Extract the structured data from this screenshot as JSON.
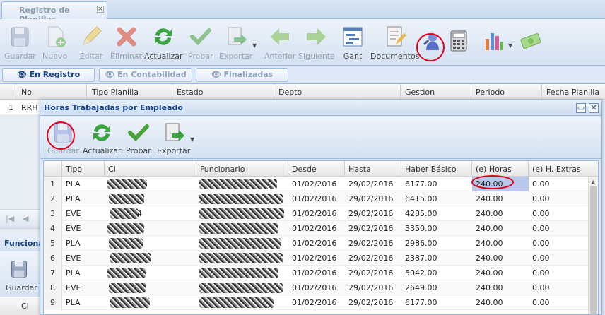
{
  "app_tab": {
    "title": "Registro de Planillas",
    "close": "×"
  },
  "toolbar": [
    {
      "label": "Guardar",
      "icon": "floppy-icon"
    },
    {
      "label": "Nuevo",
      "icon": "new-document-icon"
    },
    {
      "label": "Editar",
      "icon": "pencil-icon"
    },
    {
      "label": "Eliminar",
      "icon": "red-x-icon"
    },
    {
      "label": "Actualizar",
      "icon": "refresh-icon"
    },
    {
      "label": "Probar",
      "icon": "checkmark-icon"
    },
    {
      "label": "Exportar",
      "icon": "export-icon"
    },
    {
      "label": "Anterior",
      "icon": "arrow-left-icon"
    },
    {
      "label": "Siguiente",
      "icon": "arrow-right-icon"
    },
    {
      "label": "Gant",
      "icon": "gantt-icon"
    },
    {
      "label": "Documentos",
      "icon": "documents-icon"
    }
  ],
  "subtabs": [
    {
      "label": "En Registro",
      "icon": "eye-icon"
    },
    {
      "label": "En Contabilidad",
      "icon": "eye-icon"
    },
    {
      "label": "Finalizadas",
      "icon": "eye-icon"
    }
  ],
  "bg_grid": {
    "columns": [
      "No",
      "Tipo Planilla",
      "Estado",
      "Depto",
      "Gestion",
      "Periodo",
      "Fecha Planilla"
    ],
    "row_number": "1",
    "row_value": "RRH",
    "panel_title": "Funcionarios",
    "guardar": "Guardar",
    "ci": "CI"
  },
  "window": {
    "title": "Horas Trabajadas por Empleado",
    "toolbar": [
      {
        "label": "Guardar",
        "icon": "floppy-icon"
      },
      {
        "label": "Actualizar",
        "icon": "refresh-icon"
      },
      {
        "label": "Probar",
        "icon": "checkmark-icon"
      },
      {
        "label": "Exportar",
        "icon": "export-icon"
      }
    ],
    "columns": [
      "Tipo",
      "CI",
      "Funcionario",
      "Desde",
      "Hasta",
      "Haber Básico",
      "(e) Horas",
      "(e) H. Extras"
    ],
    "rows": [
      {
        "n": "1",
        "tipo": "PLA",
        "desde": "01/02/2016",
        "hasta": "29/02/2016",
        "haber": "6177.00",
        "horas": "240.00",
        "extras": "0.00"
      },
      {
        "n": "2",
        "tipo": "PLA",
        "desde": "01/02/2016",
        "hasta": "29/02/2016",
        "haber": "6415.00",
        "horas": "240.00",
        "extras": "0.00"
      },
      {
        "n": "3",
        "tipo": "EVE",
        "ci_tail": "4",
        "desde": "01/02/2016",
        "hasta": "29/02/2016",
        "haber": "4285.00",
        "horas": "240.00",
        "extras": "0.00"
      },
      {
        "n": "4",
        "tipo": "EVE",
        "desde": "01/02/2016",
        "hasta": "29/02/2016",
        "haber": "3350.00",
        "horas": "240.00",
        "extras": "0.00"
      },
      {
        "n": "5",
        "tipo": "PLA",
        "desde": "01/02/2016",
        "hasta": "29/02/2016",
        "haber": "2986.00",
        "horas": "240.00",
        "extras": "0.00"
      },
      {
        "n": "6",
        "tipo": "EVE",
        "desde": "01/02/2016",
        "hasta": "29/02/2016",
        "haber": "2387.00",
        "horas": "240.00",
        "extras": "0.00"
      },
      {
        "n": "7",
        "tipo": "PLA",
        "desde": "01/02/2016",
        "hasta": "29/02/2016",
        "haber": "5042.00",
        "horas": "240.00",
        "extras": "0.00"
      },
      {
        "n": "8",
        "tipo": "EVE",
        "desde": "01/02/2016",
        "hasta": "29/02/2016",
        "haber": "2649.00",
        "horas": "240.00",
        "extras": "0.00"
      },
      {
        "n": "9",
        "tipo": "PLA",
        "desde": "01/02/2016",
        "hasta": "29/02/2016",
        "haber": "6177.00",
        "horas": "240.00",
        "extras": "0.00"
      }
    ]
  },
  "colors": {
    "accent": "#15428b",
    "highlight_ring": "#e0001a",
    "selected_cell": "#b9c8ea"
  }
}
